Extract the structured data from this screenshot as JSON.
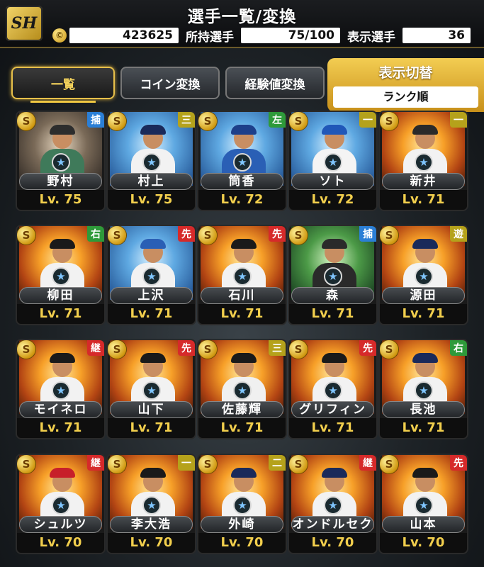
{
  "header": {
    "logo_text": "SH",
    "title": "選手一覧/変換",
    "coin_symbol": "©",
    "coins": "423625",
    "owned_label": "所持選手",
    "owned_value": "75/100",
    "shown_label": "表示選手",
    "shown_value": "36"
  },
  "tabs": {
    "list": "一覧",
    "coin_exchange": "コイン変換",
    "exp_exchange": "経験値変換",
    "toggle_label": "表示切替",
    "sort_value": "ランク順"
  },
  "cards": [
    {
      "name": "野村",
      "level": "Lv. 75",
      "position": "捕",
      "pos_color": "#2b7fd6",
      "grade": "S",
      "theme": "night",
      "uniform": "#3f7a5a",
      "cap": "#2d2d2d"
    },
    {
      "name": "村上",
      "level": "Lv. 75",
      "position": "三",
      "pos_color": "#b5a21b",
      "grade": "S",
      "theme": "cool",
      "uniform": "#f2f2f2",
      "cap": "#1a2a5a"
    },
    {
      "name": "筒香",
      "level": "Lv. 72",
      "position": "左",
      "pos_color": "#2e9a3a",
      "grade": "S",
      "theme": "cool",
      "uniform": "#2a5fb5",
      "cap": "#1d3f8a"
    },
    {
      "name": "ソト",
      "level": "Lv. 72",
      "position": "一",
      "pos_color": "#b5a21b",
      "grade": "S",
      "theme": "cool",
      "uniform": "#f4f4f4",
      "cap": "#2057b8"
    },
    {
      "name": "新井",
      "level": "Lv. 71",
      "position": "一",
      "pos_color": "#b5a21b",
      "grade": "S",
      "theme": "default",
      "uniform": "#f2f2f2",
      "cap": "#2a2a2a"
    },
    {
      "name": "柳田",
      "level": "Lv. 71",
      "position": "右",
      "pos_color": "#2e9a3a",
      "grade": "S",
      "theme": "default",
      "uniform": "#f2f2f2",
      "cap": "#1a1a1a"
    },
    {
      "name": "上沢",
      "level": "Lv. 71",
      "position": "先",
      "pos_color": "#d62a2a",
      "grade": "S",
      "theme": "cool",
      "uniform": "#f2f2f2",
      "cap": "#2a5fb5"
    },
    {
      "name": "石川",
      "level": "Lv. 71",
      "position": "先",
      "pos_color": "#d62a2a",
      "grade": "S",
      "theme": "default",
      "uniform": "#f2f2f2",
      "cap": "#1a1a1a"
    },
    {
      "name": "森",
      "level": "Lv. 71",
      "position": "捕",
      "pos_color": "#2b7fd6",
      "grade": "S",
      "theme": "green",
      "uniform": "#2a2a2a",
      "cap": "#2a2a2a"
    },
    {
      "name": "源田",
      "level": "Lv. 71",
      "position": "遊",
      "pos_color": "#b5a21b",
      "grade": "S",
      "theme": "default",
      "uniform": "#f2f2f2",
      "cap": "#1a2a5a"
    },
    {
      "name": "モイネロ",
      "level": "Lv. 71",
      "position": "継",
      "pos_color": "#d62a2a",
      "grade": "S",
      "theme": "default",
      "uniform": "#f2f2f2",
      "cap": "#1a1a1a"
    },
    {
      "name": "山下",
      "level": "Lv. 71",
      "position": "先",
      "pos_color": "#d62a2a",
      "grade": "S",
      "theme": "default",
      "uniform": "#f2f2f2",
      "cap": "#1a1a1a"
    },
    {
      "name": "佐藤輝",
      "level": "Lv. 71",
      "position": "三",
      "pos_color": "#b5a21b",
      "grade": "S",
      "theme": "default",
      "uniform": "#f0f0f0",
      "cap": "#1a1a1a"
    },
    {
      "name": "グリフィン",
      "level": "Lv. 71",
      "position": "先",
      "pos_color": "#d62a2a",
      "grade": "S",
      "theme": "default",
      "uniform": "#f2f2f2",
      "cap": "#1a1a1a"
    },
    {
      "name": "長池",
      "level": "Lv. 71",
      "position": "右",
      "pos_color": "#2e9a3a",
      "grade": "S",
      "theme": "default",
      "uniform": "#f2f2f2",
      "cap": "#1a2a5a"
    },
    {
      "name": "シュルツ",
      "level": "Lv. 70",
      "position": "継",
      "pos_color": "#d62a2a",
      "grade": "S",
      "theme": "default",
      "uniform": "#f2f2f2",
      "cap": "#c71f2a"
    },
    {
      "name": "李大浩",
      "level": "Lv. 70",
      "position": "一",
      "pos_color": "#b5a21b",
      "grade": "S",
      "theme": "default",
      "uniform": "#f2f2f2",
      "cap": "#1a1a1a"
    },
    {
      "name": "外崎",
      "level": "Lv. 70",
      "position": "二",
      "pos_color": "#b5a21b",
      "grade": "S",
      "theme": "default",
      "uniform": "#f2f2f2",
      "cap": "#1a2a5a"
    },
    {
      "name": "オンドルセク",
      "level": "Lv. 70",
      "position": "継",
      "pos_color": "#d62a2a",
      "grade": "S",
      "theme": "default",
      "uniform": "#f2f2f2",
      "cap": "#1a2a5a"
    },
    {
      "name": "山本",
      "level": "Lv. 70",
      "position": "先",
      "pos_color": "#d62a2a",
      "grade": "S",
      "theme": "default",
      "uniform": "#f2f2f2",
      "cap": "#1a1a1a"
    }
  ]
}
